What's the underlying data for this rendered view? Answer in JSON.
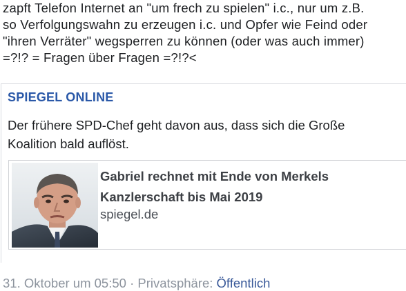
{
  "post": {
    "lines": [
      "zapft Telefon Internet an \"um frech zu spielen\" i.c., nur um z.B.",
      "so Verfolgungswahn zu erzeugen i.c. und Opfer wie Feind oder",
      "\"ihren Verräter\" wegsperren zu können (oder was auch immer)",
      "=?!? = Fragen über Fragen =?!?<"
    ]
  },
  "shared": {
    "source": "SPIEGEL ONLINE",
    "description_lines": [
      "Der frühere SPD-Chef  geht davon aus, dass sich die Große",
      "Koalition bald auflöst."
    ],
    "link": {
      "title_lines": [
        "Gabriel rechnet mit Ende von Merkels",
        "Kanzlerschaft bis Mai 2019"
      ],
      "domain": "spiegel.de",
      "thumbnail_icon": "portrait-photo-icon"
    }
  },
  "meta": {
    "date": "31. Oktober um 05:50",
    "separator": " · ",
    "privacy_label": "Privatsphäre: ",
    "privacy_value": "Öffentlich"
  },
  "colors": {
    "source_blue": "#2a58a8",
    "link_blue": "#385898",
    "meta_gray": "#8d949e"
  }
}
